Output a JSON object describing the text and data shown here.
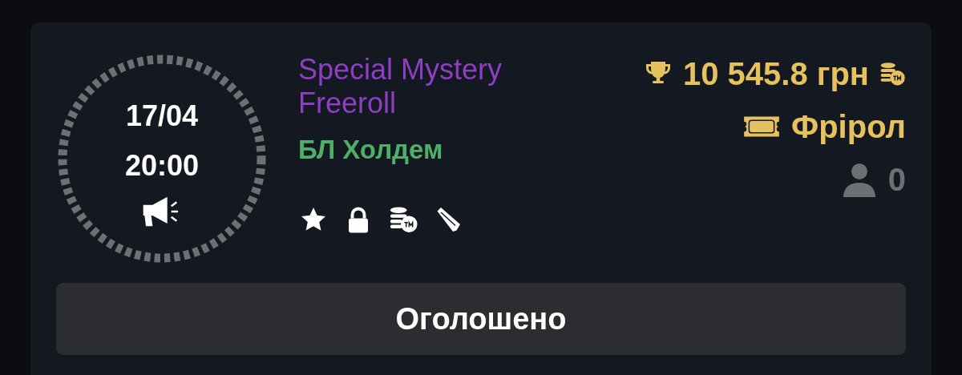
{
  "tournament": {
    "date": "17/04",
    "time": "20:00",
    "status_icon": {
      "kind": "megaphone"
    },
    "title": "Special Mystery Freeroll",
    "game": "БЛ Холдем",
    "features": [
      {
        "kind": "star"
      },
      {
        "kind": "lock"
      },
      {
        "kind": "coins"
      },
      {
        "kind": "scroll"
      }
    ],
    "prize": "10 545.8 грн",
    "buy_in": "Фрірол",
    "players": "0",
    "action": "Оголошено"
  }
}
